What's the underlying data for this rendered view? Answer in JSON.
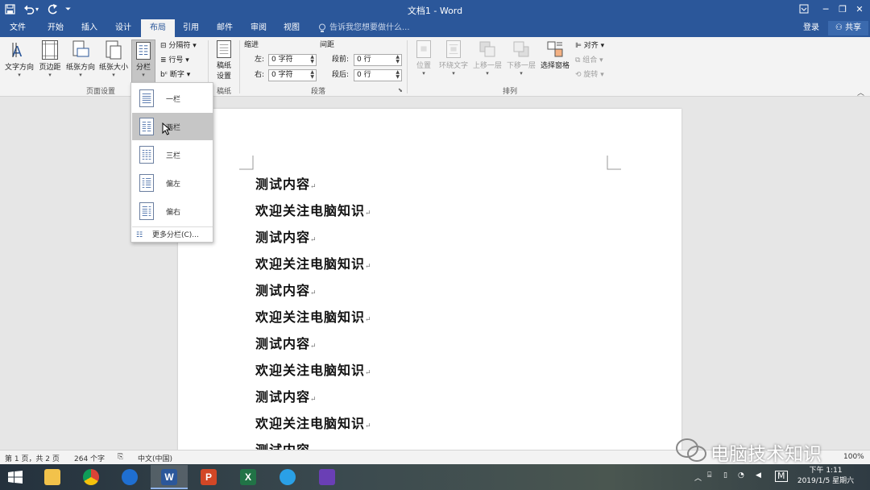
{
  "titlebar": {
    "title": "文档1 - Word",
    "save_icon": "save-icon",
    "undo_icon": "undo-icon",
    "redo_icon": "redo-icon",
    "customize_icon": "customize-qat-icon",
    "ribbon_display_icon": "ribbon-display-icon",
    "minimize_glyph": "─",
    "maximize_glyph": "❐",
    "close_glyph": "✕"
  },
  "tabs": [
    {
      "label": "文件",
      "active": false
    },
    {
      "label": "开始",
      "active": false
    },
    {
      "label": "插入",
      "active": false
    },
    {
      "label": "设计",
      "active": false
    },
    {
      "label": "布局",
      "active": true
    },
    {
      "label": "引用",
      "active": false
    },
    {
      "label": "邮件",
      "active": false
    },
    {
      "label": "审阅",
      "active": false
    },
    {
      "label": "视图",
      "active": false
    }
  ],
  "tell_me": "告诉我您想要做什么...",
  "login": "登录",
  "share": "共享",
  "ribbon": {
    "page_setup": {
      "group_label": "页面设置",
      "text_direction": "文字方向",
      "margins": "页边距",
      "orientation": "纸张方向",
      "size": "纸张大小",
      "columns": "分栏",
      "breaks": "分隔符",
      "line_numbers": "行号",
      "hyphenation": "断字"
    },
    "manuscript": {
      "group_label": "稿纸",
      "setting_line1": "稿纸",
      "setting_line2": "设置"
    },
    "paragraph": {
      "group_label": "段落",
      "indent_label": "缩进",
      "spacing_label": "间距",
      "left_label": "左:",
      "left_value": "0 字符",
      "right_label": "右:",
      "right_value": "0 字符",
      "before_label": "段前:",
      "before_value": "0 行",
      "after_label": "段后:",
      "after_value": "0 行"
    },
    "arrange": {
      "group_label": "排列",
      "position": "位置",
      "wrap_text": "环绕文字",
      "bring_forward": "上移一层",
      "send_backward": "下移一层",
      "selection_pane": "选择窗格",
      "align": "对齐",
      "group": "组合",
      "rotate": "旋转"
    }
  },
  "columns_menu": {
    "options": [
      {
        "label": "一栏",
        "highlighted": false
      },
      {
        "label": "两栏",
        "highlighted": true
      },
      {
        "label": "三栏",
        "highlighted": false
      },
      {
        "label": "偏左",
        "highlighted": false
      },
      {
        "label": "偏右",
        "highlighted": false
      }
    ],
    "more": "更多分栏(C)..."
  },
  "document": {
    "lines": [
      "测试内容",
      "欢迎关注电脑知识",
      "测试内容",
      "欢迎关注电脑知识",
      "测试内容",
      "欢迎关注电脑知识",
      "测试内容",
      "欢迎关注电脑知识",
      "测试内容",
      "欢迎关注电脑知识",
      "测试内容"
    ],
    "paragraph_mark": "↵"
  },
  "statusbar": {
    "page": "第 1 页，共 2 页",
    "words": "264 个字",
    "language": "中文(中国)",
    "zoom": "100%"
  },
  "taskbar": {
    "apps": [
      "start-icon",
      "file-explorer-icon",
      "chrome-icon",
      "app-icon",
      "word-icon",
      "powerpoint-icon",
      "excel-icon",
      "edge-icon",
      "video-app-icon"
    ],
    "tray_m": "M",
    "time": "下午 1:11",
    "date": "2019/1/5 星期六"
  },
  "watermark": {
    "text": "电脑技术知识"
  }
}
